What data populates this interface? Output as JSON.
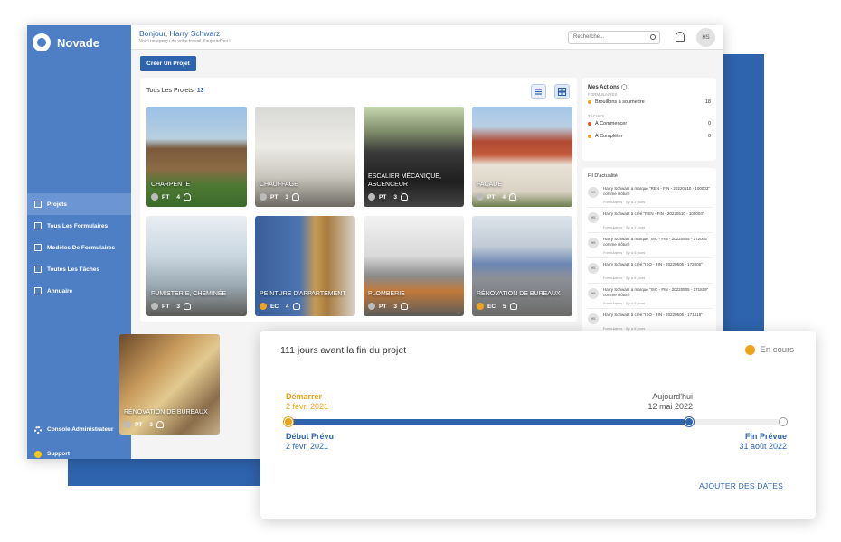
{
  "brand": {
    "name": "Novade"
  },
  "header": {
    "greeting": "Bonjour, Harry Schwarz",
    "subtitle": "Voici un aperçu de votre travail d'aujourd'hui !",
    "search_placeholder": "Recherche...",
    "avatar_initials": "HS"
  },
  "sidebar": {
    "items": [
      {
        "label": "Projets",
        "icon": "folder-icon"
      },
      {
        "label": "Tous Les Formulaires",
        "icon": "document-icon"
      },
      {
        "label": "Modèles De Formulaires",
        "icon": "template-icon"
      },
      {
        "label": "Toutes Les Tâches",
        "icon": "list-icon"
      },
      {
        "label": "Annuaire",
        "icon": "people-icon"
      }
    ],
    "bottom": [
      {
        "label": "Console Administrateur",
        "icon": "gear-icon"
      },
      {
        "label": "Support",
        "icon": "support-icon"
      }
    ]
  },
  "actions": {
    "create_project": "Créer Un Projet"
  },
  "projects": {
    "title": "Tous Les Projets",
    "count": "13",
    "cards": [
      {
        "title": "CHARPENTE",
        "status": "PT",
        "members": "4"
      },
      {
        "title": "CHAUFFAGE",
        "status": "PT",
        "members": "3"
      },
      {
        "title": "ESCALIER MÉCANIQUE, ASCENCEUR",
        "status": "PT",
        "members": "3"
      },
      {
        "title": "FAÇADE",
        "status": "PT",
        "members": "4"
      },
      {
        "title": "FUMISTERIE, CHEMINÉE",
        "status": "PT",
        "members": "3"
      },
      {
        "title": "PEINTURE D'APPARTEMENT",
        "status": "EC",
        "members": "4"
      },
      {
        "title": "PLOMBERIE",
        "status": "PT",
        "members": "3"
      },
      {
        "title": "RÉNOVATION DE BUREAUX",
        "status": "EC",
        "members": "5"
      },
      {
        "title": "RÉNOVATION DE BUREAUX",
        "status": "PT",
        "members": "3"
      }
    ]
  },
  "my_actions": {
    "title": "Mes Actions",
    "forms_section": "FORMULAIRES",
    "forms": [
      {
        "label": "Brouillons à soumettre",
        "count": "18"
      }
    ],
    "tasks_section": "TÂCHES",
    "tasks": [
      {
        "label": "À Commencer",
        "count": "0"
      },
      {
        "label": "À Compléter",
        "count": "0"
      }
    ]
  },
  "feed": {
    "title": "Fil D'actualité",
    "items": [
      {
        "text": "Harry Schwarz a marqué \"REN - FIN - 20220510 - 100003\" comme clôturé",
        "meta": "Formulaires · Il y a 2 jours"
      },
      {
        "text": "Harry Schwarz a créé \"REN - FIN - 20220510 - 100003\"",
        "meta": "Formulaires · Il y a 2 jours"
      },
      {
        "text": "Harry Schwarz a marqué \"ISO - FIN - 20220505 - 172005\" comme clôturé",
        "meta": "Formulaires · Il y a 6 jours"
      },
      {
        "text": "Harry Schwarz a créé \"ISO - FIN - 20220505 - 172005\"",
        "meta": "Formulaires · Il y a 6 jours"
      },
      {
        "text": "Harry Schwarz a marqué \"ISO - FIN - 20220505 - 171819\" comme clôturé",
        "meta": "Formulaires · Il y a 6 jours"
      },
      {
        "text": "Harry Schwarz a créé \"ISO - FIN - 20220505 - 171819\"",
        "meta": "Formulaires · Il y a 6 jours"
      }
    ]
  },
  "timeline": {
    "title": "111 jours avant la fin du projet",
    "status": "En cours",
    "start_label": "Démarrer",
    "start_date": "2 févr. 2021",
    "today_label": "Aujourd'hui",
    "today_date": "12 mai 2022",
    "planned_start_label": "Début Prévu",
    "planned_start_date": "2 févr. 2021",
    "planned_end_label": "Fin Prévue",
    "planned_end_date": "31 août 2022",
    "progress": 0.81,
    "add_dates": "AJOUTER DES DATES",
    "colors": {
      "accent": "#2e63ad",
      "start": "#e8a317",
      "status": "#f0a21b"
    }
  }
}
